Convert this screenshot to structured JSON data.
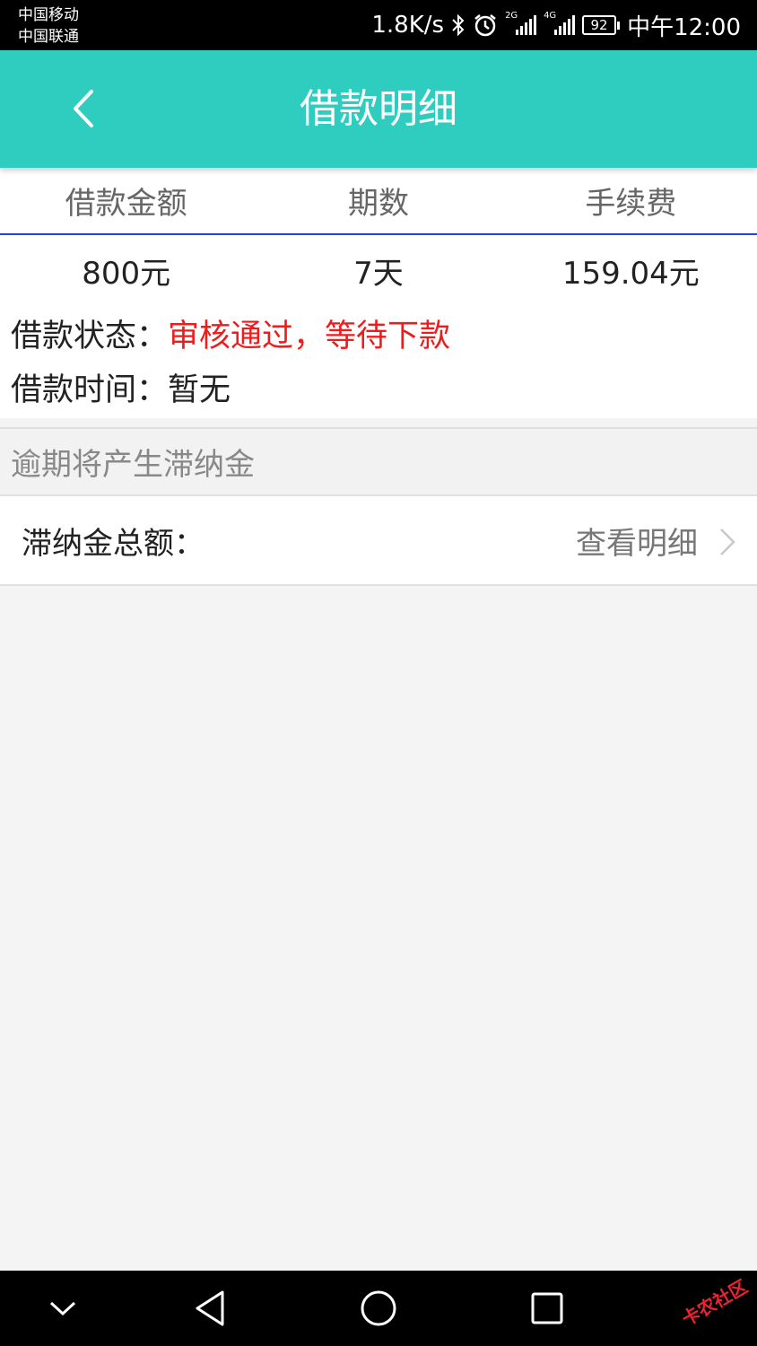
{
  "status_bar": {
    "carrier_1": "中国移动",
    "carrier_2": "中国联通",
    "net_speed": "1.8K/s",
    "sim1_tag": "2G",
    "sim2_tag": "4G",
    "battery": "92",
    "time": "中午12:00",
    "icons": [
      "bluetooth-icon",
      "alarm-icon",
      "signal-icon",
      "battery-icon"
    ]
  },
  "header": {
    "title": "借款明细",
    "back_icon": "chevron-left-icon",
    "color": "#2ecdc0"
  },
  "summary": {
    "columns": [
      {
        "label": "借款金额",
        "value": "800元"
      },
      {
        "label": "期数",
        "value": "7天"
      },
      {
        "label": "手续费",
        "value": "159.04元"
      }
    ]
  },
  "details": {
    "status_label": "借款状态：",
    "status_value": "审核通过，等待下款",
    "status_color": "#ee1c1c",
    "time_label": "借款时间：",
    "time_value": "暂无"
  },
  "notice": "逾期将产生滞纳金",
  "late_fee": {
    "label": "滞纳金总额：",
    "link": "查看明细",
    "icon": "chevron-right-icon"
  },
  "nav": {
    "icons": [
      "collapse-icon",
      "back-triangle-icon",
      "home-circle-icon",
      "recents-square-icon"
    ],
    "watermark": "卡农社区"
  }
}
